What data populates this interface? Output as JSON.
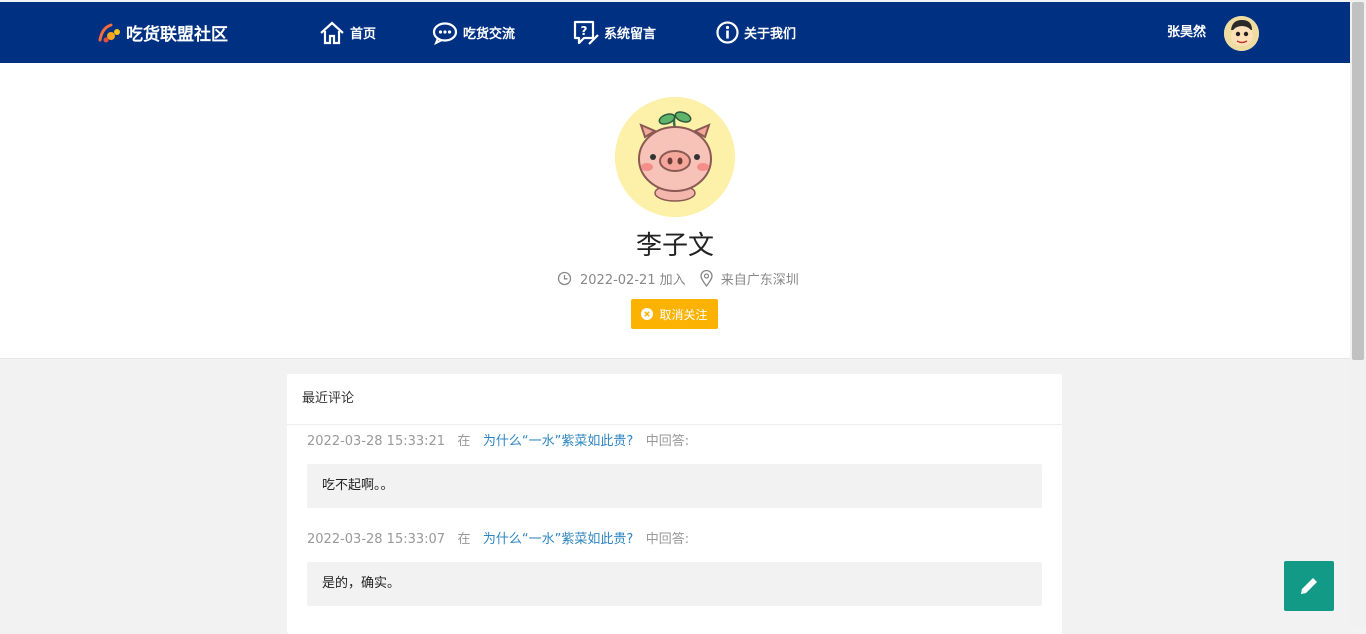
{
  "nav": {
    "brand": "吃货联盟社区",
    "items": [
      {
        "label": "首页",
        "icon": "home-icon"
      },
      {
        "label": "吃货交流",
        "icon": "chat-icon"
      },
      {
        "label": "系统留言",
        "icon": "message-icon"
      },
      {
        "label": "关于我们",
        "icon": "info-icon"
      }
    ],
    "user_name": "张昊然"
  },
  "profile": {
    "name": "李子文",
    "joined": "2022-02-21 加入",
    "location": "来自广东深圳",
    "unfollow_label": "取消关注"
  },
  "comments": {
    "title": "最近评论",
    "items": [
      {
        "time": "2022-03-28 15:33:21",
        "pre": "在",
        "topic": "为什么“一水”紫菜如此贵?",
        "post": "中回答:",
        "text": "吃不起啊。。"
      },
      {
        "time": "2022-03-28 15:33:07",
        "pre": "在",
        "topic": "为什么“一水”紫菜如此贵?",
        "post": "中回答:",
        "text": "是的，确实。"
      }
    ]
  },
  "colors": {
    "nav_bg": "#003082",
    "accent_yellow": "#fbb200",
    "fab_green": "#129a86",
    "link_blue": "#2e86c1"
  }
}
